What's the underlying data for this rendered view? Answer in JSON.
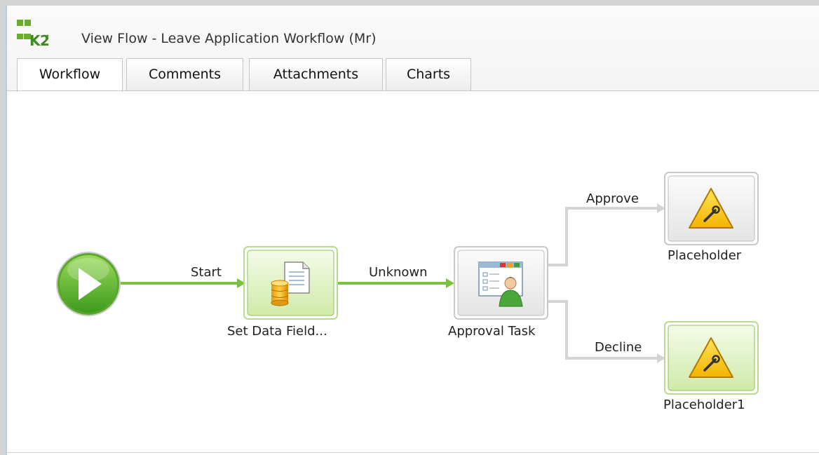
{
  "window": {
    "logo_text": "K2",
    "title": "View Flow - Leave Application Workflow (Mr)"
  },
  "tabs": [
    {
      "label": "Workflow",
      "active": true
    },
    {
      "label": "Comments",
      "active": false
    },
    {
      "label": "Attachments",
      "active": false
    },
    {
      "label": "Charts",
      "active": false
    }
  ],
  "workflow": {
    "nodes": [
      {
        "id": "start",
        "type": "start-event",
        "label": ""
      },
      {
        "id": "set-data",
        "type": "server-event",
        "label": "Set Data Field..."
      },
      {
        "id": "approval",
        "type": "client-event",
        "label": "Approval Task"
      },
      {
        "id": "placeholder",
        "type": "placeholder",
        "label": "Placeholder"
      },
      {
        "id": "placeholder1",
        "type": "placeholder",
        "label": "Placeholder1"
      }
    ],
    "lines": [
      {
        "label": "Start",
        "from": "start",
        "to": "set-data",
        "state": "completed"
      },
      {
        "label": "Unknown",
        "from": "set-data",
        "to": "approval",
        "state": "completed"
      },
      {
        "label": "Approve",
        "from": "approval",
        "to": "placeholder",
        "state": "inactive"
      },
      {
        "label": "Decline",
        "from": "approval",
        "to": "placeholder1",
        "state": "inactive"
      }
    ]
  },
  "colors": {
    "active_green": "#7cc242",
    "inactive_gray": "#d4d4d4",
    "brand_green": "#6aac2f"
  }
}
